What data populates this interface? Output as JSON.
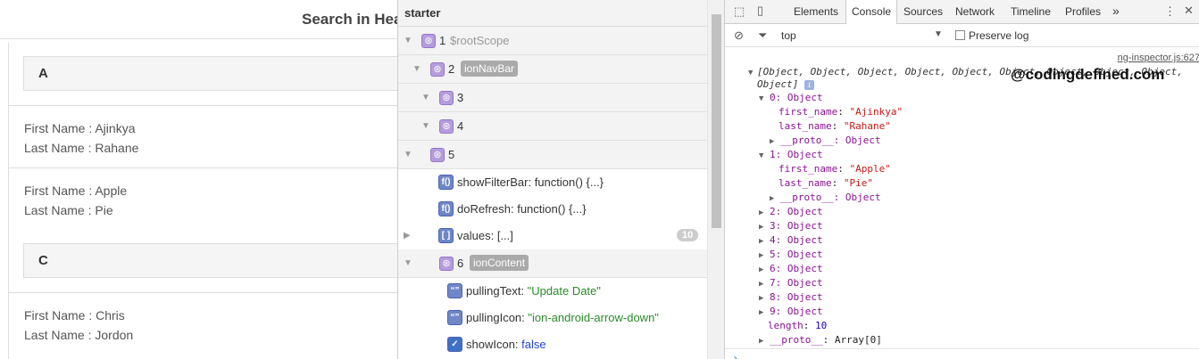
{
  "app": {
    "title": "Search in Hea",
    "sections": [
      {
        "letter": "A",
        "contacts": [
          {
            "first": "First Name : Ajinkya",
            "last": "Last Name : Rahane"
          },
          {
            "first": "First Name : Apple",
            "last": "Last Name : Pie"
          }
        ]
      },
      {
        "letter": "C",
        "contacts": [
          {
            "first": "First Name : Chris",
            "last": "Last Name : Jordon"
          }
        ]
      }
    ]
  },
  "inspector": {
    "title": "starter",
    "scopes": [
      {
        "num": "1",
        "label": "$rootScope"
      },
      {
        "num": "2",
        "badge": "ionNavBar"
      },
      {
        "num": "3"
      },
      {
        "num": "4"
      },
      {
        "num": "5"
      },
      {
        "num": "6",
        "badge": "ionContent"
      }
    ],
    "props5": [
      {
        "icon": "f()",
        "name": "showFilterBar",
        "value": "function() {...}"
      },
      {
        "icon": "f()",
        "name": "doRefresh",
        "value": "function() {...}"
      },
      {
        "icon": "[ ]",
        "name": "values",
        "value": "[...]",
        "count": "10"
      }
    ],
    "props6": [
      {
        "icon": "“”",
        "name": "pullingText",
        "value": "\"Update Date\""
      },
      {
        "icon": "“”",
        "name": "pullingIcon",
        "value": "\"ion-android-arrow-down\""
      },
      {
        "icon": "✓",
        "name": "showIcon",
        "value": "false"
      }
    ]
  },
  "devtools": {
    "tabs": [
      "Elements",
      "Console",
      "Sources",
      "Network",
      "Timeline",
      "Profiles"
    ],
    "more": "»",
    "context": "top",
    "preserve_log": "Preserve log",
    "source_link": "ng-inspector.js:627",
    "watermark": "@codingdefined.com",
    "summary_line1": "[Object, Object, Object, Object, Object, Object, Object, Object, Object,",
    "summary_line2": "Object]",
    "info": "i",
    "obj0": {
      "label": "0: Object",
      "first_key": "first_name",
      "first_val": "\"Ajinkya\"",
      "last_key": "last_name",
      "last_val": "\"Rahane\"",
      "proto": "__proto__: Object"
    },
    "obj1": {
      "label": "1: Object",
      "first_key": "first_name",
      "first_val": "\"Apple\"",
      "last_key": "last_name",
      "last_val": "\"Pie\"",
      "proto": "__proto__: Object"
    },
    "collapsed": [
      "2: Object",
      "3: Object",
      "4: Object",
      "5: Object",
      "6: Object",
      "7: Object",
      "8: Object",
      "9: Object"
    ],
    "length_key": "length",
    "length_val": "10",
    "array_proto_key": "__proto__",
    "array_proto_val": "Array[0]",
    "prompt": "›"
  }
}
